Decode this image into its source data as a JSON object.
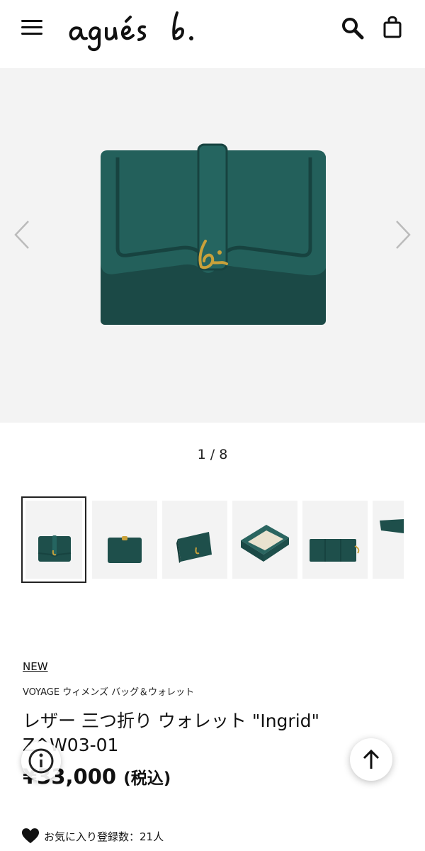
{
  "header": {
    "logo_text": "agnès b.",
    "icons": [
      "hamburger-menu-icon",
      "search-icon",
      "shopping-bag-icon"
    ]
  },
  "gallery": {
    "counter": "1 / 8",
    "total_images": 8,
    "current_index": 1,
    "thumbnails_visible": 6,
    "product_color": "#1f5450",
    "accent_color": "#c9a13a"
  },
  "product": {
    "badge": "NEW",
    "category": "VOYAGE ウィメンズ バッグ＆ウォレット",
    "title": "レザー 三つ折り ウォレット \"Ingrid\" Z^W03-01",
    "price": "¥33,000",
    "tax_label": "(税込)",
    "favorites": "お気に入り登録数：21人"
  }
}
